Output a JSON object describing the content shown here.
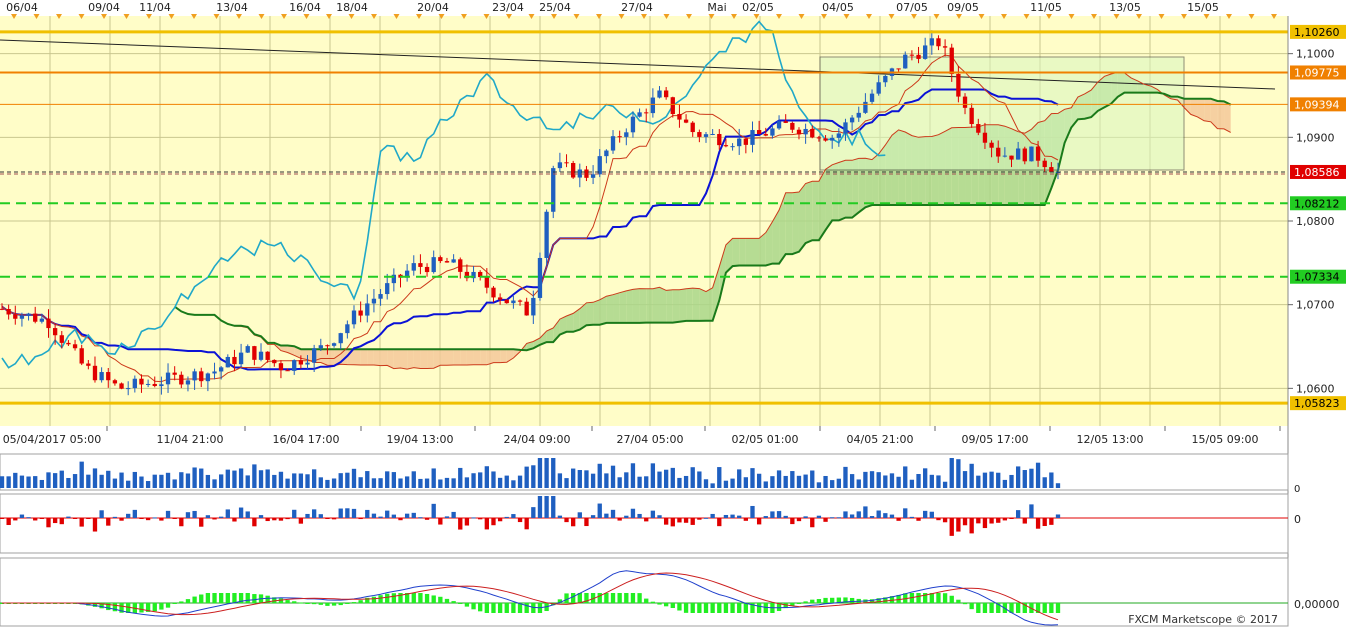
{
  "colors": {
    "bg": "#fffdc8",
    "grid": "#c9c78f",
    "up": "#1f5fc0",
    "down": "#e00000",
    "ichimoku_tenkan": "#0b12d6",
    "ichimoku_kijun": "#1a7a1a",
    "chikou": "#20a8c8",
    "senkou_a": "#cc3a1a",
    "cloud_bull": "#a9d68a",
    "cloud_bear": "#f4c89a",
    "gold": "#f0c000",
    "orange": "#f08000",
    "green_dash": "#22cc22",
    "macd_hist": "#22ee22",
    "macd_line": "#2040cc",
    "signal_line": "#cc2020"
  },
  "chart_data": {
    "type": "candlestick",
    "instrument_note": "",
    "top_axis_dates": [
      "06/04",
      "09/04",
      "11/04",
      "13/04",
      "16/04",
      "18/04",
      "20/04",
      "23/04",
      "25/04",
      "27/04",
      "Mai",
      "02/05",
      "04/05",
      "07/05",
      "09/05",
      "11/05",
      "13/05",
      "15/05"
    ],
    "bottom_axis_labels": [
      "05/04/2017 05:00",
      "11/04 21:00",
      "16/04 17:00",
      "19/04 13:00",
      "24/04 09:00",
      "27/04 05:00",
      "02/05 01:00",
      "04/05 21:00",
      "09/05 17:00",
      "12/05 13:00",
      "15/05 09:00"
    ],
    "y_ticks": [
      "1,1000",
      "1,0900",
      "1,0800",
      "1,0700",
      "1,0600"
    ],
    "y_tick_values": [
      1.1,
      1.09,
      1.08,
      1.07,
      1.06
    ],
    "ylim": [
      1.0555,
      1.1045
    ],
    "price_levels": [
      {
        "label": "1,10260",
        "value": 1.1026,
        "kind": "gold"
      },
      {
        "label": "1,09775",
        "value": 1.09775,
        "kind": "orange"
      },
      {
        "label": "1,09394",
        "value": 1.09394,
        "kind": "orange-thin"
      },
      {
        "label": "1,08586",
        "value": 1.08586,
        "kind": "current"
      },
      {
        "label": "1,08212",
        "value": 1.08212,
        "kind": "green"
      },
      {
        "label": "1,07334",
        "value": 1.07334,
        "kind": "green"
      },
      {
        "label": "1,05823",
        "value": 1.05823,
        "kind": "gold"
      }
    ],
    "lower_panel_zero_label": "0",
    "macd_zero_label": "0,00000",
    "copyright": "FXCM Marketscope © 2017"
  }
}
